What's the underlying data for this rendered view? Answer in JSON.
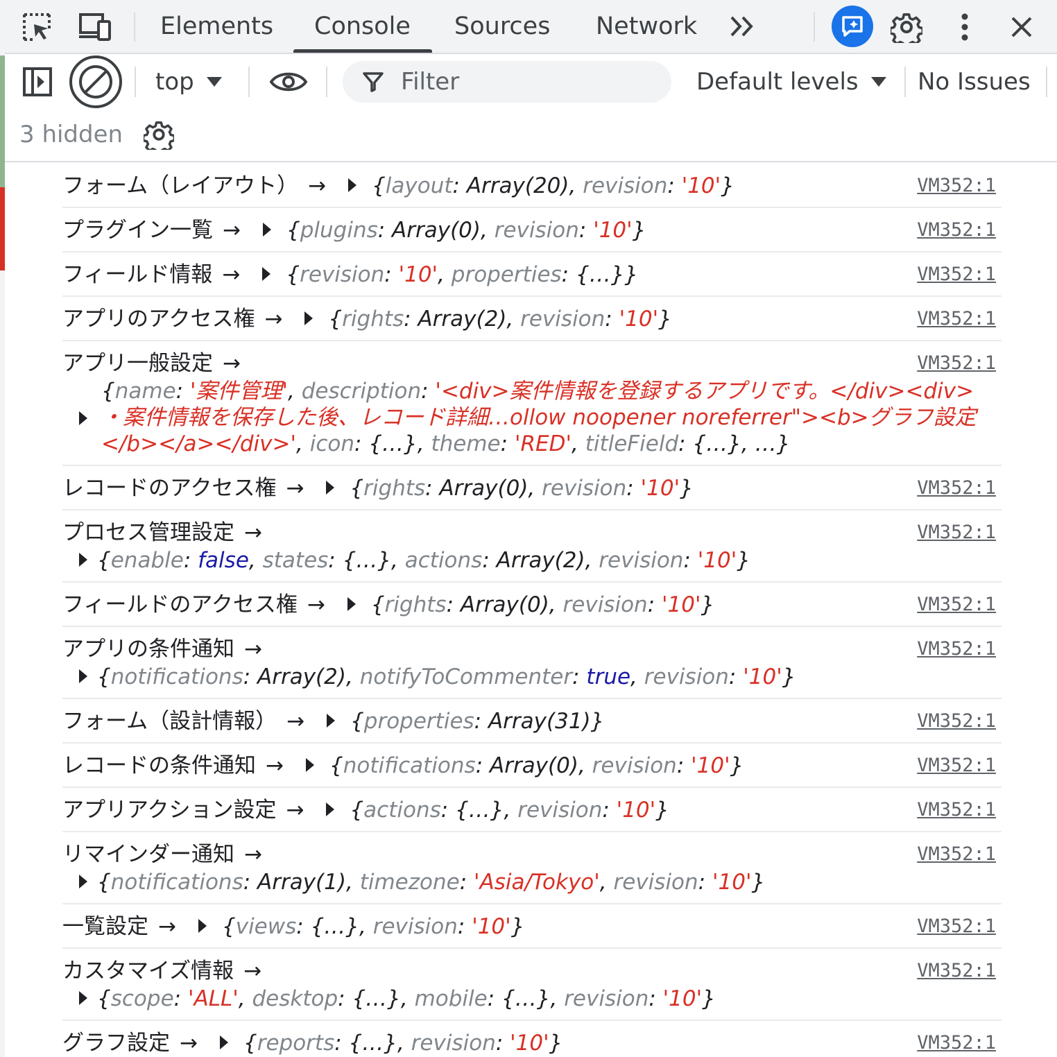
{
  "tabbar": {
    "tabs": [
      {
        "label": "Elements",
        "active": false
      },
      {
        "label": "Console",
        "active": true
      },
      {
        "label": "Sources",
        "active": false
      },
      {
        "label": "Network",
        "active": false
      }
    ]
  },
  "toolbar": {
    "context": "top",
    "filter_placeholder": "Filter",
    "levels": "Default levels",
    "issues": "No Issues",
    "hidden": "3 hidden"
  },
  "colors": {
    "accent": "#1a73e8",
    "string": "#d93025",
    "boolean": "#1a1aa6",
    "key": "#80868b"
  },
  "messages": [
    {
      "label": "フォーム（レイアウト）",
      "arrow": "→",
      "source": "VM352:1",
      "parts": [
        [
          "p",
          "{"
        ],
        [
          "k",
          "layout"
        ],
        [
          "p",
          ": Array(20), "
        ],
        [
          "k",
          "revision"
        ],
        [
          "p",
          ": "
        ],
        [
          "s",
          "'10'"
        ],
        [
          "p",
          "}"
        ]
      ]
    },
    {
      "label": "プラグイン一覧",
      "arrow": "→",
      "source": "VM352:1",
      "parts": [
        [
          "p",
          "{"
        ],
        [
          "k",
          "plugins"
        ],
        [
          "p",
          ": Array(0), "
        ],
        [
          "k",
          "revision"
        ],
        [
          "p",
          ": "
        ],
        [
          "s",
          "'10'"
        ],
        [
          "p",
          "}"
        ]
      ]
    },
    {
      "label": "フィールド情報",
      "arrow": "→",
      "source": "VM352:1",
      "parts": [
        [
          "p",
          "{"
        ],
        [
          "k",
          "revision"
        ],
        [
          "p",
          ": "
        ],
        [
          "s",
          "'10'"
        ],
        [
          "p",
          ", "
        ],
        [
          "k",
          "properties"
        ],
        [
          "p",
          ": {…}}"
        ]
      ]
    },
    {
      "label": "アプリのアクセス権",
      "arrow": "→",
      "source": "VM352:1",
      "parts": [
        [
          "p",
          "{"
        ],
        [
          "k",
          "rights"
        ],
        [
          "p",
          ": Array(2), "
        ],
        [
          "k",
          "revision"
        ],
        [
          "p",
          ": "
        ],
        [
          "s",
          "'10'"
        ],
        [
          "p",
          "}"
        ]
      ]
    },
    {
      "label": "アプリ一般設定",
      "arrow": "→",
      "source": "VM352:1",
      "layout": "multi",
      "parts": [
        [
          "p",
          "{"
        ],
        [
          "k",
          "name"
        ],
        [
          "p",
          ": "
        ],
        [
          "s",
          "'案件管理'"
        ],
        [
          "p",
          ", "
        ],
        [
          "k",
          "description"
        ],
        [
          "p",
          ": "
        ],
        [
          "s",
          "'<div>案件情報を登録するアプリです。</div><div> ・案件情報を保存した後、レコード詳細…ollow noopener noreferrer\"><b>グラフ設定</b></a></div>'"
        ],
        [
          "p",
          ", "
        ],
        [
          "k",
          "icon"
        ],
        [
          "p",
          ": {…}, "
        ],
        [
          "k",
          "theme"
        ],
        [
          "p",
          ": "
        ],
        [
          "s",
          "'RED'"
        ],
        [
          "p",
          ", "
        ],
        [
          "k",
          "titleField"
        ],
        [
          "p",
          ": {…},  …}"
        ]
      ]
    },
    {
      "label": "レコードのアクセス権",
      "arrow": "→",
      "source": "VM352:1",
      "parts": [
        [
          "p",
          "{"
        ],
        [
          "k",
          "rights"
        ],
        [
          "p",
          ": Array(0), "
        ],
        [
          "k",
          "revision"
        ],
        [
          "p",
          ": "
        ],
        [
          "s",
          "'10'"
        ],
        [
          "p",
          "}"
        ]
      ]
    },
    {
      "label": "プロセス管理設定",
      "arrow": "→",
      "source": "VM352:1",
      "layout": "wrap",
      "parts": [
        [
          "p",
          "{"
        ],
        [
          "k",
          "enable"
        ],
        [
          "p",
          ": "
        ],
        [
          "b",
          "false"
        ],
        [
          "p",
          ", "
        ],
        [
          "k",
          "states"
        ],
        [
          "p",
          ": {…}, "
        ],
        [
          "k",
          "actions"
        ],
        [
          "p",
          ": Array(2), "
        ],
        [
          "k",
          "revision"
        ],
        [
          "p",
          ": "
        ],
        [
          "s",
          "'10'"
        ],
        [
          "p",
          "}"
        ]
      ]
    },
    {
      "label": "フィールドのアクセス権",
      "arrow": "→",
      "source": "VM352:1",
      "parts": [
        [
          "p",
          "{"
        ],
        [
          "k",
          "rights"
        ],
        [
          "p",
          ": Array(0), "
        ],
        [
          "k",
          "revision"
        ],
        [
          "p",
          ": "
        ],
        [
          "s",
          "'10'"
        ],
        [
          "p",
          "}"
        ]
      ]
    },
    {
      "label": "アプリの条件通知",
      "arrow": "→",
      "source": "VM352:1",
      "layout": "wrap",
      "parts": [
        [
          "p",
          "{"
        ],
        [
          "k",
          "notifications"
        ],
        [
          "p",
          ": Array(2), "
        ],
        [
          "k",
          "notifyToCommenter"
        ],
        [
          "p",
          ": "
        ],
        [
          "b",
          "true"
        ],
        [
          "p",
          ", "
        ],
        [
          "k",
          "revision"
        ],
        [
          "p",
          ": "
        ],
        [
          "s",
          "'10'"
        ],
        [
          "p",
          "}"
        ]
      ]
    },
    {
      "label": "フォーム（設計情報）",
      "arrow": "→",
      "source": "VM352:1",
      "parts": [
        [
          "p",
          "{"
        ],
        [
          "k",
          "properties"
        ],
        [
          "p",
          ": Array(31)}"
        ]
      ]
    },
    {
      "label": "レコードの条件通知",
      "arrow": "→",
      "source": "VM352:1",
      "parts": [
        [
          "p",
          "{"
        ],
        [
          "k",
          "notifications"
        ],
        [
          "p",
          ": Array(0), "
        ],
        [
          "k",
          "revision"
        ],
        [
          "p",
          ": "
        ],
        [
          "s",
          "'10'"
        ],
        [
          "p",
          "}"
        ]
      ]
    },
    {
      "label": "アプリアクション設定",
      "arrow": "→",
      "source": "VM352:1",
      "parts": [
        [
          "p",
          "{"
        ],
        [
          "k",
          "actions"
        ],
        [
          "p",
          ": {…}, "
        ],
        [
          "k",
          "revision"
        ],
        [
          "p",
          ": "
        ],
        [
          "s",
          "'10'"
        ],
        [
          "p",
          "}"
        ]
      ]
    },
    {
      "label": "リマインダー通知",
      "arrow": "→",
      "source": "VM352:1",
      "layout": "wrap",
      "parts": [
        [
          "p",
          "{"
        ],
        [
          "k",
          "notifications"
        ],
        [
          "p",
          ": Array(1), "
        ],
        [
          "k",
          "timezone"
        ],
        [
          "p",
          ": "
        ],
        [
          "s",
          "'Asia/Tokyo'"
        ],
        [
          "p",
          ", "
        ],
        [
          "k",
          "revision"
        ],
        [
          "p",
          ": "
        ],
        [
          "s",
          "'10'"
        ],
        [
          "p",
          "}"
        ]
      ]
    },
    {
      "label": "一覧設定",
      "arrow": "→",
      "source": "VM352:1",
      "parts": [
        [
          "p",
          "{"
        ],
        [
          "k",
          "views"
        ],
        [
          "p",
          ": {…}, "
        ],
        [
          "k",
          "revision"
        ],
        [
          "p",
          ": "
        ],
        [
          "s",
          "'10'"
        ],
        [
          "p",
          "}"
        ]
      ]
    },
    {
      "label": "カスタマイズ情報",
      "arrow": "→",
      "source": "VM352:1",
      "layout": "wrap",
      "parts": [
        [
          "p",
          "{"
        ],
        [
          "k",
          "scope"
        ],
        [
          "p",
          ": "
        ],
        [
          "s",
          "'ALL'"
        ],
        [
          "p",
          ", "
        ],
        [
          "k",
          "desktop"
        ],
        [
          "p",
          ": {…}, "
        ],
        [
          "k",
          "mobile"
        ],
        [
          "p",
          ": {…}, "
        ],
        [
          "k",
          "revision"
        ],
        [
          "p",
          ": "
        ],
        [
          "s",
          "'10'"
        ],
        [
          "p",
          "}"
        ]
      ]
    },
    {
      "label": "グラフ設定",
      "arrow": "→",
      "source": "VM352:1",
      "parts": [
        [
          "p",
          "{"
        ],
        [
          "k",
          "reports"
        ],
        [
          "p",
          ": {…}, "
        ],
        [
          "k",
          "revision"
        ],
        [
          "p",
          ": "
        ],
        [
          "s",
          "'10'"
        ],
        [
          "p",
          "}"
        ]
      ]
    }
  ]
}
